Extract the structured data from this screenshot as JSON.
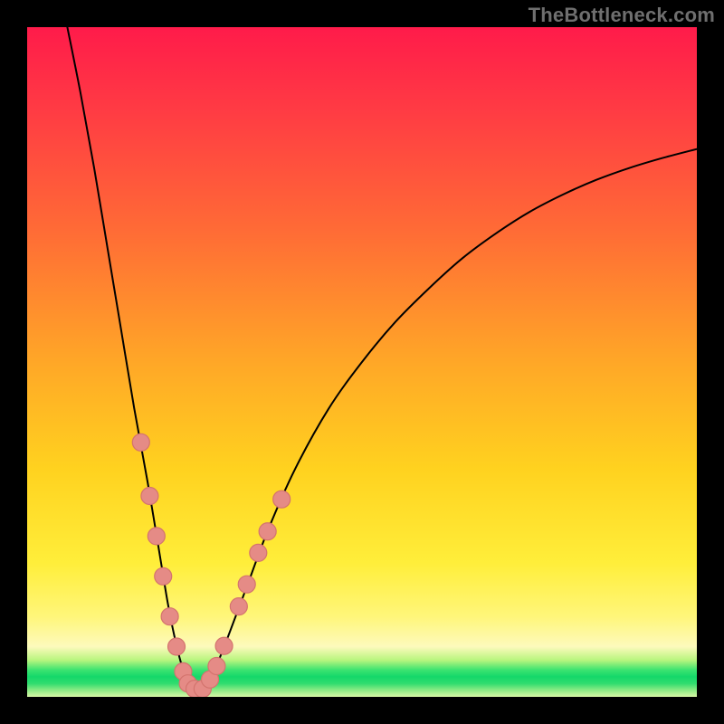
{
  "watermark": "TheBottleneck.com",
  "colors": {
    "dot_fill": "#e58b86",
    "dot_stroke": "#d4746e",
    "line": "#000000"
  },
  "chart_data": {
    "type": "line",
    "title": "",
    "xlabel": "",
    "ylabel": "",
    "xlim": [
      0,
      100
    ],
    "ylim": [
      0,
      100
    ],
    "annotations": [],
    "series": [
      {
        "name": "bottleneck-curve-left",
        "x": [
          6,
          8,
          10,
          12,
          14,
          16,
          18,
          20,
          21,
          22,
          23,
          24,
          24.5,
          25
        ],
        "y": [
          100,
          90,
          79,
          67,
          55,
          43,
          32,
          20,
          14,
          9,
          5,
          2.4,
          1.4,
          1
        ]
      },
      {
        "name": "bottleneck-curve-right",
        "x": [
          25,
          26,
          27,
          28,
          30,
          33,
          36,
          40,
          45,
          50,
          55,
          60,
          65,
          70,
          75,
          80,
          85,
          90,
          95,
          100
        ],
        "y": [
          1,
          1.2,
          2.2,
          4,
          9,
          17,
          25,
          34,
          43,
          50,
          56,
          61,
          65.5,
          69.2,
          72.4,
          75,
          77.2,
          79,
          80.5,
          81.8
        ]
      }
    ],
    "markers": [
      {
        "x": 17.0,
        "y": 38.0
      },
      {
        "x": 18.3,
        "y": 30.0
      },
      {
        "x": 19.3,
        "y": 24.0
      },
      {
        "x": 20.3,
        "y": 18.0
      },
      {
        "x": 21.3,
        "y": 12.0
      },
      {
        "x": 22.3,
        "y": 7.5
      },
      {
        "x": 23.3,
        "y": 3.8
      },
      {
        "x": 24.0,
        "y": 2.0
      },
      {
        "x": 25.0,
        "y": 1.2
      },
      {
        "x": 26.2,
        "y": 1.2
      },
      {
        "x": 27.3,
        "y": 2.6
      },
      {
        "x": 28.3,
        "y": 4.6
      },
      {
        "x": 29.4,
        "y": 7.6
      },
      {
        "x": 31.6,
        "y": 13.5
      },
      {
        "x": 32.8,
        "y": 16.8
      },
      {
        "x": 34.5,
        "y": 21.5
      },
      {
        "x": 35.9,
        "y": 24.7
      },
      {
        "x": 38.0,
        "y": 29.5
      }
    ]
  }
}
